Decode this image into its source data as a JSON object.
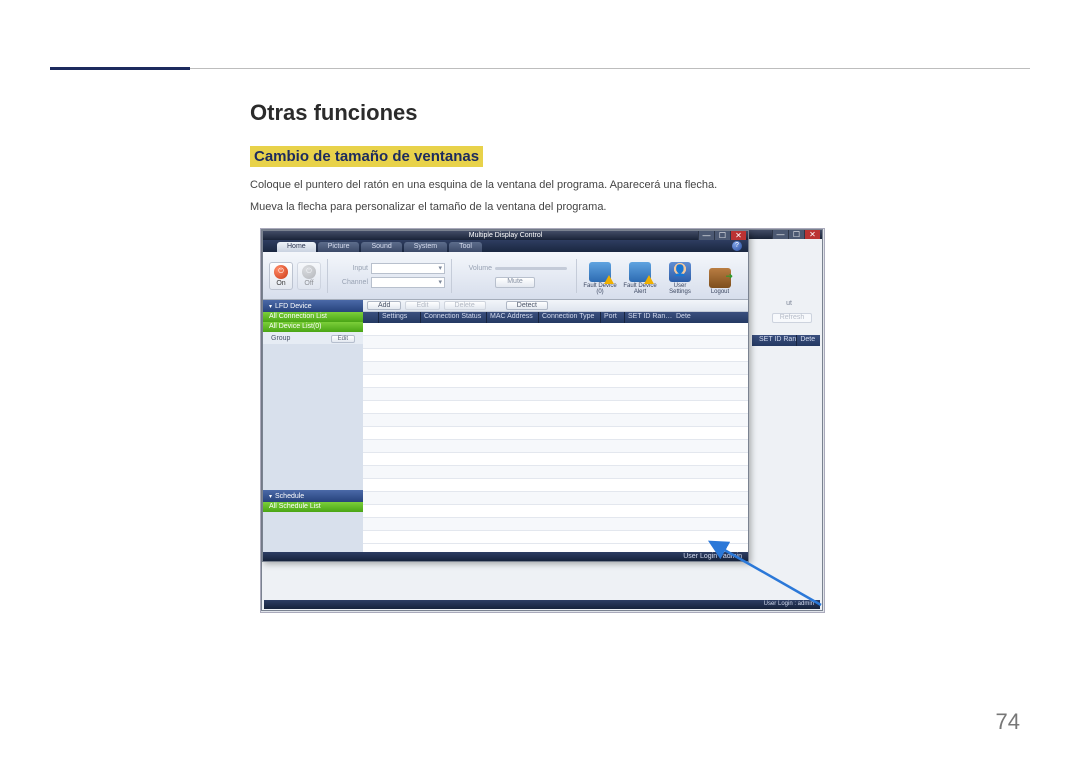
{
  "page": {
    "heading1": "Otras funciones",
    "heading2": "Cambio de tamaño de ventanas",
    "para1": "Coloque el puntero del ratón en una esquina de la ventana del programa. Aparecerá una flecha.",
    "para2": "Mueva la flecha para personalizar el tamaño de la ventana del programa.",
    "page_number": "74"
  },
  "app": {
    "title": "Multiple Display Control",
    "tabs": [
      "Home",
      "Picture",
      "Sound",
      "System",
      "Tool"
    ],
    "help": "?",
    "toolbar": {
      "power_on": "On",
      "power_off": "Off",
      "input_label": "Input",
      "channel_label": "Channel",
      "volume_label": "Volume",
      "volume_value": "",
      "mute": "Mute",
      "fault_device": "Fault Device (0)",
      "fault_device_alert": "Fault Device Alert",
      "user_settings": "User Settings",
      "logout": "Logout"
    },
    "sidebar": {
      "lfd_device": "LFD Device",
      "all_connection_list": "All Connection List",
      "all_device_list": "All Device List(0)",
      "group": "Group",
      "edit": "Edit",
      "schedule": "Schedule",
      "all_schedule_list": "All Schedule List"
    },
    "actions": {
      "add": "Add",
      "edit": "Edit",
      "delete": "Delete",
      "detect": "Detect"
    },
    "columns": [
      "",
      "Settings",
      "Connection Status",
      "MAC Address",
      "Connection Type",
      "Port",
      "SET ID Ran…",
      "Dete"
    ],
    "back_columns": [
      "SET ID Ran…",
      "Dete"
    ],
    "back_refresh": "Refresh",
    "back_frag": "ut",
    "status": "User Login : admin",
    "back_status": "User Login : admin",
    "window_controls": {
      "min": "—",
      "max": "☐",
      "close": "✕"
    }
  }
}
